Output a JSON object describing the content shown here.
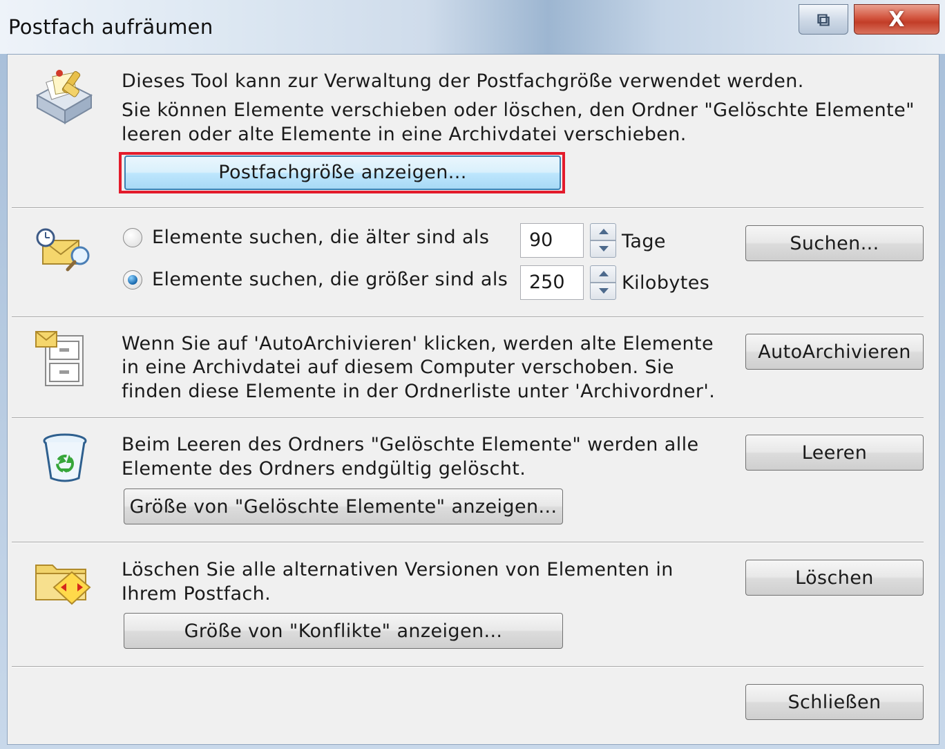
{
  "window": {
    "title": "Postfach aufräumen",
    "restore_glyph": "⧉",
    "close_glyph": "X"
  },
  "intro": {
    "line1": "Dieses Tool kann zur Verwaltung der Postfachgröße verwendet werden.",
    "line2": "Sie können Elemente verschieben oder löschen, den Ordner \"Gelöschte Elemente\"",
    "line3": "leeren oder alte Elemente in eine Archivdatei verschieben.",
    "view_size_button": "Postfachgröße anzeigen...",
    "icon": "mailbox-cleanup-icon"
  },
  "find": {
    "icon": "find-items-icon",
    "older_label": "Elemente suchen, die älter sind als",
    "older_value": "90",
    "older_unit": "Tage",
    "older_selected": false,
    "larger_label": "Elemente suchen, die größer sind als",
    "larger_value": "250",
    "larger_unit": "Kilobytes",
    "larger_selected": true,
    "search_button": "Suchen..."
  },
  "autoarchive": {
    "icon": "archive-cabinet-icon",
    "line1": "Wenn Sie auf 'AutoArchivieren' klicken, werden alte Elemente",
    "line2": "in eine Archivdatei auf diesem Computer verschoben. Sie",
    "line3": "finden diese Elemente in der Ordnerliste unter 'Archivordner'.",
    "button": "AutoArchivieren"
  },
  "deleted": {
    "icon": "recycle-bin-icon",
    "line1": "Beim Leeren des Ordners \"Gelöschte Elemente\" werden alle",
    "line2": "Elemente des Ordners endgültig gelöscht.",
    "empty_button": "Leeren",
    "size_button": "Größe von \"Gelöschte Elemente\" anzeigen..."
  },
  "conflicts": {
    "icon": "conflicts-folder-icon",
    "line1": "Löschen Sie alle alternativen Versionen von Elementen in",
    "line2": "Ihrem Postfach.",
    "delete_button": "Löschen",
    "size_button": "Größe von \"Konflikte\" anzeigen..."
  },
  "footer": {
    "close_button": "Schließen"
  },
  "colors": {
    "highlight": "#e31b2b",
    "panel": "#f0f0f0"
  }
}
